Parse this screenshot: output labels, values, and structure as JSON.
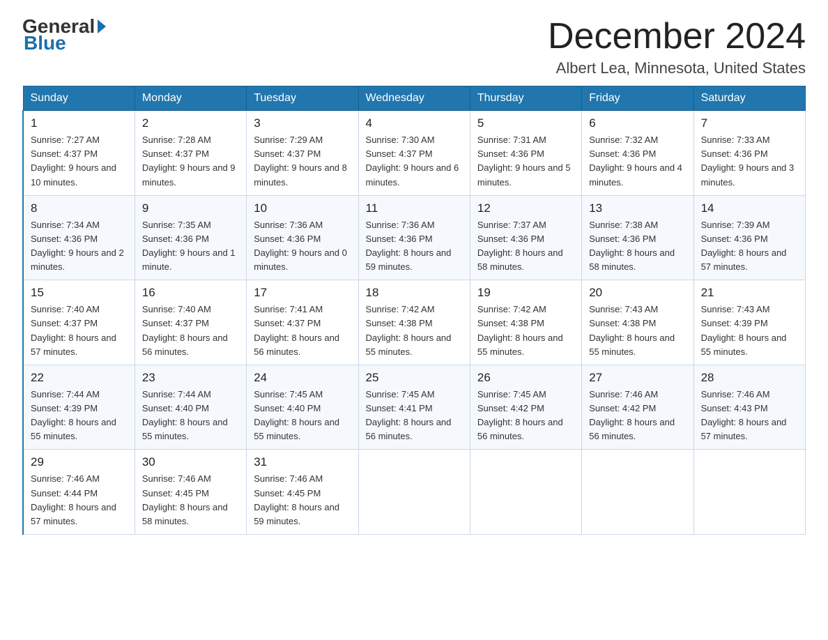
{
  "header": {
    "logo_line1": "General",
    "logo_line2": "Blue",
    "month_title": "December 2024",
    "location": "Albert Lea, Minnesota, United States"
  },
  "days_of_week": [
    "Sunday",
    "Monday",
    "Tuesday",
    "Wednesday",
    "Thursday",
    "Friday",
    "Saturday"
  ],
  "weeks": [
    [
      {
        "day": "1",
        "sunrise": "7:27 AM",
        "sunset": "4:37 PM",
        "daylight": "9 hours and 10 minutes."
      },
      {
        "day": "2",
        "sunrise": "7:28 AM",
        "sunset": "4:37 PM",
        "daylight": "9 hours and 9 minutes."
      },
      {
        "day": "3",
        "sunrise": "7:29 AM",
        "sunset": "4:37 PM",
        "daylight": "9 hours and 8 minutes."
      },
      {
        "day": "4",
        "sunrise": "7:30 AM",
        "sunset": "4:37 PM",
        "daylight": "9 hours and 6 minutes."
      },
      {
        "day": "5",
        "sunrise": "7:31 AM",
        "sunset": "4:36 PM",
        "daylight": "9 hours and 5 minutes."
      },
      {
        "day": "6",
        "sunrise": "7:32 AM",
        "sunset": "4:36 PM",
        "daylight": "9 hours and 4 minutes."
      },
      {
        "day": "7",
        "sunrise": "7:33 AM",
        "sunset": "4:36 PM",
        "daylight": "9 hours and 3 minutes."
      }
    ],
    [
      {
        "day": "8",
        "sunrise": "7:34 AM",
        "sunset": "4:36 PM",
        "daylight": "9 hours and 2 minutes."
      },
      {
        "day": "9",
        "sunrise": "7:35 AM",
        "sunset": "4:36 PM",
        "daylight": "9 hours and 1 minute."
      },
      {
        "day": "10",
        "sunrise": "7:36 AM",
        "sunset": "4:36 PM",
        "daylight": "9 hours and 0 minutes."
      },
      {
        "day": "11",
        "sunrise": "7:36 AM",
        "sunset": "4:36 PM",
        "daylight": "8 hours and 59 minutes."
      },
      {
        "day": "12",
        "sunrise": "7:37 AM",
        "sunset": "4:36 PM",
        "daylight": "8 hours and 58 minutes."
      },
      {
        "day": "13",
        "sunrise": "7:38 AM",
        "sunset": "4:36 PM",
        "daylight": "8 hours and 58 minutes."
      },
      {
        "day": "14",
        "sunrise": "7:39 AM",
        "sunset": "4:36 PM",
        "daylight": "8 hours and 57 minutes."
      }
    ],
    [
      {
        "day": "15",
        "sunrise": "7:40 AM",
        "sunset": "4:37 PM",
        "daylight": "8 hours and 57 minutes."
      },
      {
        "day": "16",
        "sunrise": "7:40 AM",
        "sunset": "4:37 PM",
        "daylight": "8 hours and 56 minutes."
      },
      {
        "day": "17",
        "sunrise": "7:41 AM",
        "sunset": "4:37 PM",
        "daylight": "8 hours and 56 minutes."
      },
      {
        "day": "18",
        "sunrise": "7:42 AM",
        "sunset": "4:38 PM",
        "daylight": "8 hours and 55 minutes."
      },
      {
        "day": "19",
        "sunrise": "7:42 AM",
        "sunset": "4:38 PM",
        "daylight": "8 hours and 55 minutes."
      },
      {
        "day": "20",
        "sunrise": "7:43 AM",
        "sunset": "4:38 PM",
        "daylight": "8 hours and 55 minutes."
      },
      {
        "day": "21",
        "sunrise": "7:43 AM",
        "sunset": "4:39 PM",
        "daylight": "8 hours and 55 minutes."
      }
    ],
    [
      {
        "day": "22",
        "sunrise": "7:44 AM",
        "sunset": "4:39 PM",
        "daylight": "8 hours and 55 minutes."
      },
      {
        "day": "23",
        "sunrise": "7:44 AM",
        "sunset": "4:40 PM",
        "daylight": "8 hours and 55 minutes."
      },
      {
        "day": "24",
        "sunrise": "7:45 AM",
        "sunset": "4:40 PM",
        "daylight": "8 hours and 55 minutes."
      },
      {
        "day": "25",
        "sunrise": "7:45 AM",
        "sunset": "4:41 PM",
        "daylight": "8 hours and 56 minutes."
      },
      {
        "day": "26",
        "sunrise": "7:45 AM",
        "sunset": "4:42 PM",
        "daylight": "8 hours and 56 minutes."
      },
      {
        "day": "27",
        "sunrise": "7:46 AM",
        "sunset": "4:42 PM",
        "daylight": "8 hours and 56 minutes."
      },
      {
        "day": "28",
        "sunrise": "7:46 AM",
        "sunset": "4:43 PM",
        "daylight": "8 hours and 57 minutes."
      }
    ],
    [
      {
        "day": "29",
        "sunrise": "7:46 AM",
        "sunset": "4:44 PM",
        "daylight": "8 hours and 57 minutes."
      },
      {
        "day": "30",
        "sunrise": "7:46 AM",
        "sunset": "4:45 PM",
        "daylight": "8 hours and 58 minutes."
      },
      {
        "day": "31",
        "sunrise": "7:46 AM",
        "sunset": "4:45 PM",
        "daylight": "8 hours and 59 minutes."
      },
      null,
      null,
      null,
      null
    ]
  ],
  "labels": {
    "sunrise_prefix": "Sunrise: ",
    "sunset_prefix": "Sunset: ",
    "daylight_prefix": "Daylight: "
  }
}
